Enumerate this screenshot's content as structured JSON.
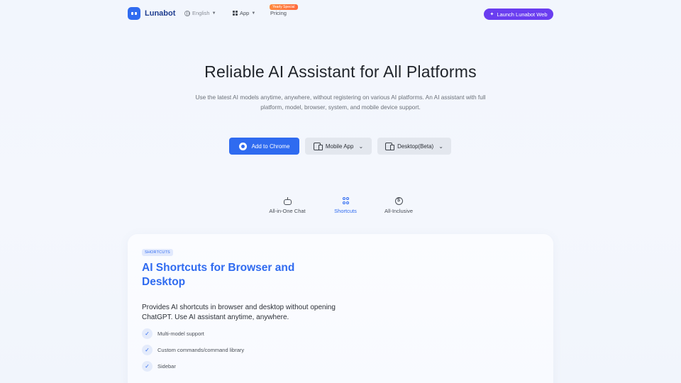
{
  "nav": {
    "brand": "Lunabot",
    "language": "English",
    "app": "App",
    "pricing": "Pricing",
    "promo_badge": "Yearly Special",
    "launch_button": "Launch Lunabot Web",
    "accent_color": "#6a3df0"
  },
  "hero": {
    "title": "Reliable AI Assistant for All Platforms",
    "subtitle": "Use the latest AI models anytime, anywhere, without registering on various AI platforms. An AI assistant with full platform, model, browser, system, and mobile device support.",
    "buttons": {
      "chrome": "Add to Chrome",
      "mobile": "Mobile App",
      "desktop": "Desktop(Beta)"
    },
    "primary_color": "#2f6bf0"
  },
  "tabs": [
    {
      "label": "All-in-One Chat",
      "icon": "robot-icon",
      "active": false
    },
    {
      "label": "Shortcuts",
      "icon": "clover-icon",
      "active": true
    },
    {
      "label": "All-Inclusive",
      "icon": "dollar-coin-icon",
      "active": false
    }
  ],
  "card": {
    "tag": "SHORTCUTS",
    "title": "AI Shortcuts for Browser and Desktop",
    "description": "Provides AI shortcuts in browser and desktop without opening ChatGPT. Use AI assistant anytime, anywhere.",
    "features": [
      "Multi-model support",
      "Custom commands/command library",
      "Sidebar"
    ]
  }
}
